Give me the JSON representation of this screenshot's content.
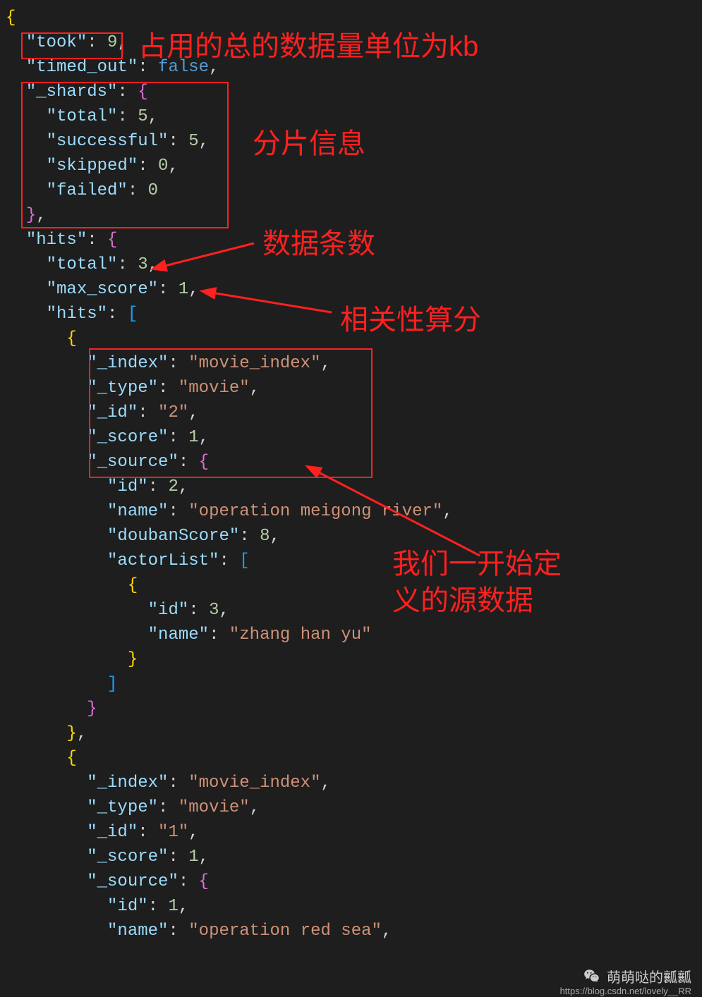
{
  "annotations": {
    "a1": "占用的总的数据量单位为kb",
    "a2": "分片信息",
    "a3": "数据条数",
    "a4": "相关性算分",
    "a5_l1": "我们一开始定",
    "a5_l2": "义的源数据"
  },
  "code": {
    "l1": "{",
    "l2_k": "\"took\"",
    "l2_v": "9",
    "l3_k": "\"timed_out\"",
    "l3_v": "false",
    "l4_k": "\"_shards\"",
    "l5_k": "\"total\"",
    "l5_v": "5",
    "l6_k": "\"successful\"",
    "l6_v": "5",
    "l7_k": "\"skipped\"",
    "l7_v": "0",
    "l8_k": "\"failed\"",
    "l8_v": "0",
    "l10_k": "\"hits\"",
    "l11_k": "\"total\"",
    "l11_v": "3",
    "l12_k": "\"max_score\"",
    "l12_v": "1",
    "l13_k": "\"hits\"",
    "l15_k": "\"_index\"",
    "l15_v": "\"movie_index\"",
    "l16_k": "\"_type\"",
    "l16_v": "\"movie\"",
    "l17_k": "\"_id\"",
    "l17_v": "\"2\"",
    "l18_k": "\"_score\"",
    "l18_v": "1",
    "l19_k": "\"_source\"",
    "l20_k": "\"id\"",
    "l20_v": "2",
    "l21_k": "\"name\"",
    "l21_v": "\"operation meigong river\"",
    "l22_k": "\"doubanScore\"",
    "l22_v": "8",
    "l23_k": "\"actorList\"",
    "l25_k": "\"id\"",
    "l25_v": "3",
    "l26_k": "\"name\"",
    "l26_v": "\"zhang han yu\"",
    "l32_k": "\"_index\"",
    "l32_v": "\"movie_index\"",
    "l33_k": "\"_type\"",
    "l33_v": "\"movie\"",
    "l34_k": "\"_id\"",
    "l34_v": "\"1\"",
    "l35_k": "\"_score\"",
    "l35_v": "1",
    "l36_k": "\"_source\"",
    "l37_k": "\"id\"",
    "l37_v": "1",
    "l38_k": "\"name\"",
    "l38_v": "\"operation red sea\""
  },
  "watermark": {
    "name": "萌萌哒的瓤瓤",
    "url": "https://blog.csdn.net/lovely__RR"
  }
}
